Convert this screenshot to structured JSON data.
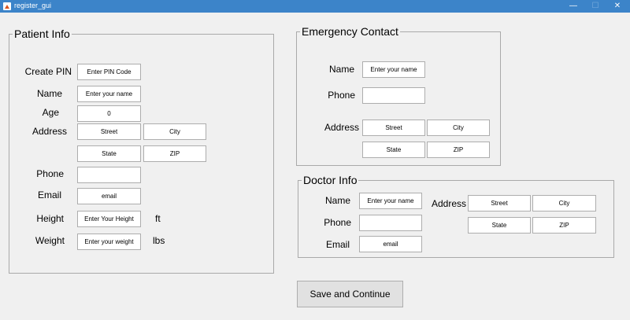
{
  "window": {
    "title": "register_gui",
    "minimize_icon": "minimize-icon",
    "maximize_icon": "maximize-icon",
    "close_icon": "close-icon"
  },
  "patient": {
    "legend": "Patient Info",
    "pin_label": "Create PIN",
    "pin_value": "Enter PIN Code",
    "name_label": "Name",
    "name_value": "Enter your name",
    "age_label": "Age",
    "age_value": "0",
    "address_label": "Address",
    "street_value": "Street",
    "city_value": "City",
    "state_value": "State",
    "zip_value": "ZIP",
    "phone_label": "Phone",
    "phone_value": "",
    "email_label": "Email",
    "email_value": "email",
    "height_label": "Height",
    "height_value": "Enter Your Height",
    "height_unit": "ft",
    "weight_label": "Weight",
    "weight_value": "Enter your weight",
    "weight_unit": "lbs"
  },
  "emergency": {
    "legend": "Emergency Contact",
    "name_label": "Name",
    "name_value": "Enter your name",
    "phone_label": "Phone",
    "phone_value": "",
    "address_label": "Address",
    "street_value": "Street",
    "city_value": "City",
    "state_value": "State",
    "zip_value": "ZIP"
  },
  "doctor": {
    "legend": "Doctor Info",
    "name_label": "Name",
    "name_value": "Enter your name",
    "phone_label": "Phone",
    "phone_value": "",
    "email_label": "Email",
    "email_value": "email",
    "address_label": "Address",
    "street_value": "Street",
    "city_value": "City",
    "state_value": "State",
    "zip_value": "ZIP"
  },
  "actions": {
    "save_label": "Save and Continue"
  }
}
